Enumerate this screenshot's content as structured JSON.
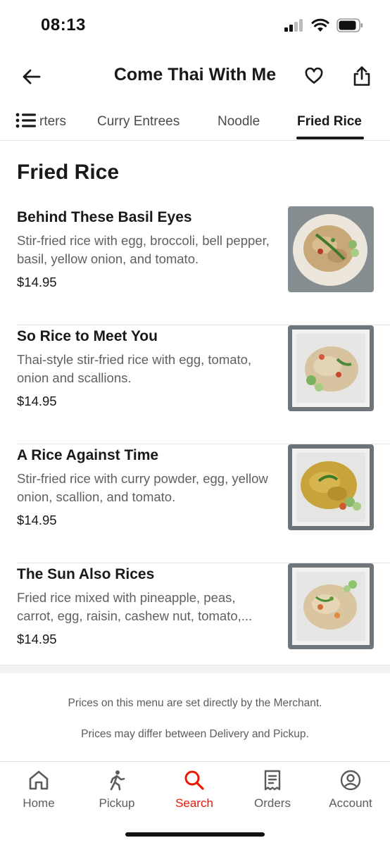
{
  "status_bar": {
    "time": "08:13"
  },
  "header": {
    "title": "Come Thai With Me"
  },
  "tabs": {
    "partial_label": "Starters",
    "items": [
      "Curry Entrees",
      "Noodle",
      "Fried Rice"
    ]
  },
  "section": {
    "title": "Fried Rice"
  },
  "menu_items": [
    {
      "name": "Behind These Basil Eyes",
      "description": "Stir-fried rice with egg, broccoli, bell pepper, basil, yellow onion, and tomato.",
      "price": "$14.95"
    },
    {
      "name": "So Rice to Meet You",
      "description": "Thai-style stir-fried rice with egg, tomato, onion and scallions.",
      "price": "$14.95"
    },
    {
      "name": "A Rice Against Time",
      "description": "Stir-fried rice with curry powder, egg, yellow onion, scallion, and tomato.",
      "price": "$14.95"
    },
    {
      "name": "The Sun Also Rices",
      "description_line1": "Fried rice mixed with pineapple, peas,",
      "description_line2": "carrot, egg, raisin, cashew nut, tomato,...",
      "price": "$14.95"
    }
  ],
  "disclaimers": [
    "Prices on this menu are set directly by the Merchant.",
    "Prices may differ between Delivery and Pickup."
  ],
  "bottom_nav": [
    {
      "label": "Home",
      "icon": "home-icon"
    },
    {
      "label": "Pickup",
      "icon": "walking-person-icon"
    },
    {
      "label": "Search",
      "icon": "search-icon",
      "active": true
    },
    {
      "label": "Orders",
      "icon": "receipt-icon"
    },
    {
      "label": "Account",
      "icon": "account-icon"
    }
  ],
  "colors": {
    "accent": "#eb1700",
    "text": "#191919",
    "muted": "#606060"
  }
}
